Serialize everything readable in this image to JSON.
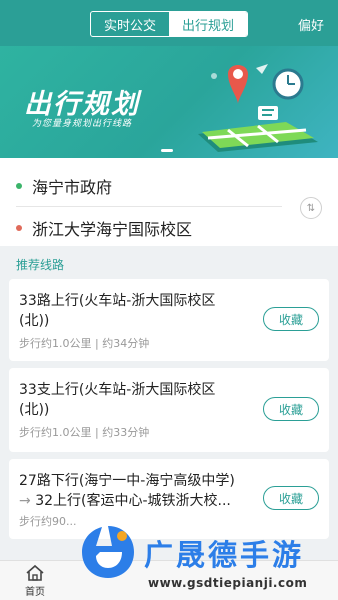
{
  "header": {
    "tabs": [
      {
        "label": "实时公交",
        "active": false
      },
      {
        "label": "出行规划",
        "active": true
      }
    ],
    "right_link": "偏好"
  },
  "banner": {
    "title": "出行规划",
    "subtitle": "为您量身规划出行线路"
  },
  "route_input": {
    "from": "海宁市政府",
    "to": "浙江大学海宁国际校区",
    "swap_symbol": "⇅"
  },
  "recommend": {
    "title": "推荐线路",
    "routes": [
      {
        "line1": "33路上行(火车站-浙大国际校区",
        "line2": "(北))",
        "meta": "步行约1.0公里 | 约34分钟",
        "fav": "收藏"
      },
      {
        "line1": "33支上行(火车站-浙大国际校区",
        "line2": "(北))",
        "meta": "步行约1.0公里 | 约33分钟",
        "fav": "收藏"
      },
      {
        "line1": "27路下行(海宁一中-海宁高级中学)",
        "arrow": "→",
        "line2": "32上行(客运中心-城铁浙大校...",
        "meta": "步行约90...",
        "fav": "收藏"
      }
    ]
  },
  "tabbar": {
    "home_label": "首页"
  },
  "watermark": {
    "name": "广晟德手游",
    "url": "www.gsdtiepianji.com"
  },
  "colors": {
    "primary": "#2b9f96",
    "from_dot": "#3bb46a",
    "to_dot": "#e06a5a",
    "watermark": "#2c7ee8"
  }
}
